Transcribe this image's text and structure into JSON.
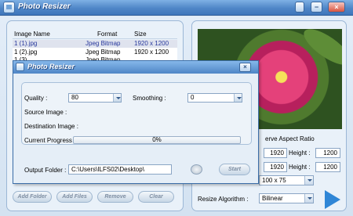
{
  "window": {
    "title": "Photo Resizer"
  },
  "titlebar_buttons": {
    "minimize": "−",
    "close": "×"
  },
  "file_list": {
    "headers": {
      "name": "Image Name",
      "format": "Format",
      "size": "Size"
    },
    "rows": [
      {
        "name": "1 (1).jpg",
        "format": "Jpeg Bitmap",
        "size": "1920 x 1200"
      },
      {
        "name": "1 (2).jpg",
        "format": "Jpeg Bitmap",
        "size": "1920 x 1200"
      },
      {
        "name": "1 (3)...",
        "format": "Jpeg Bitmap",
        "size": "..."
      }
    ]
  },
  "buttons": {
    "add_folder": "Add Folder",
    "add_files": "Add Files",
    "remove": "Remove",
    "clear": "Clear"
  },
  "resize_panel": {
    "aspect_label": "erve Aspect Ratio",
    "width_value_1": "1920",
    "height_label_1": "Height :",
    "height_value_1": "1200",
    "width_value_2": "1920",
    "height_label_2": "Height :",
    "height_value_2": "1200",
    "preset": "100 x 75",
    "algorithm_label": "Resize Algorithm :",
    "algorithm": "Bilinear"
  },
  "dialog": {
    "title": "Photo Resizer",
    "close": "×",
    "quality_label": "Quality :",
    "quality_value": "80",
    "smoothing_label": "Smoothing :",
    "smoothing_value": "0",
    "source_label": "Source Image :",
    "destination_label": "Destination Image :",
    "progress_label": "Current Progress",
    "progress_value": 0,
    "progress_text": "0%",
    "output_label": "Output Folder :",
    "output_value": "C:\\Users\\ILFS02\\Desktop\\",
    "start_label": "Start"
  },
  "colors": {
    "titlebar": "#4f86c7",
    "accent": "#2f86d6",
    "selection_text": "#27379c"
  },
  "icons": [
    "app-icon",
    "minimize-icon",
    "close-icon",
    "dropdown-arrow-icon",
    "browse-icon",
    "go-arrow-icon"
  ]
}
